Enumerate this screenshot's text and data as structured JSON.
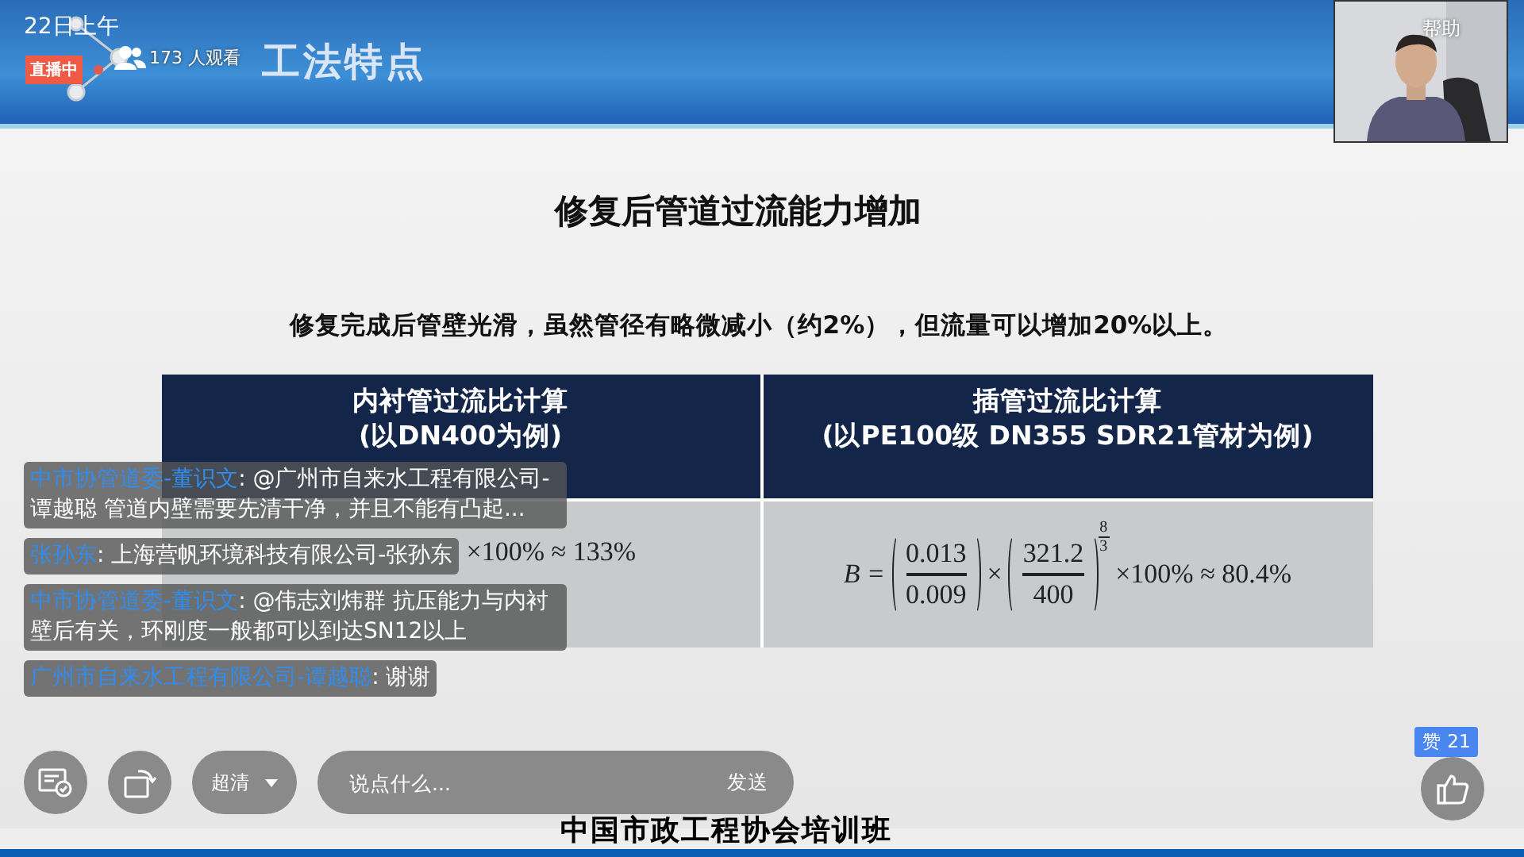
{
  "live": {
    "date": "22日上午",
    "badge": "直播中",
    "viewers": "173 人观看"
  },
  "slide": {
    "section_title": "工法特点",
    "title": "修复后管道过流能力增加",
    "subtitle": "修复完成后管壁光滑，虽然管径有略微减小（约2%），但流量可以增加20%以上。",
    "table": {
      "columns": [
        {
          "title": "内衬管过流比计算",
          "subtitle": "(以DN400为例)"
        },
        {
          "title": "插管过流比计算",
          "subtitle": "(以PE100级 DN355  SDR21管材为例)"
        }
      ],
      "formulas": [
        {
          "tail": "×100% ≈ 133%"
        },
        {
          "lhs": "B =",
          "operator": "×",
          "tail": "×100% ≈ 80.4%",
          "factors": [
            {
              "num": "0.013",
              "den": "0.009"
            },
            {
              "num": "321.2",
              "den": "400",
              "exp_num": "8",
              "exp_den": "3"
            }
          ]
        }
      ]
    },
    "footer": "中国市政工程协会培训班"
  },
  "presenter": {
    "label": "帮助"
  },
  "chat": [
    {
      "name": "中市协管道委-董识文",
      "text": ": @广州市自来水工程有限公司-谭越聪 管道内壁需要先清干净，并且不能有凸起..."
    },
    {
      "name": "张孙东",
      "text": ": 上海营帆环境科技有限公司-张孙东"
    },
    {
      "name": "中市协管道委-董识文",
      "text": ": @伟志刘炜群 抗压能力与内衬壁后有关，环刚度一般都可以到达SN12以上"
    },
    {
      "name": "广州市自来水工程有限公司-谭越聪",
      "text": ": 谢谢"
    }
  ],
  "controls": {
    "quality": "超清",
    "message": {
      "placeholder": "说点什么..."
    },
    "send": "发送",
    "likes": "赞 21"
  }
}
